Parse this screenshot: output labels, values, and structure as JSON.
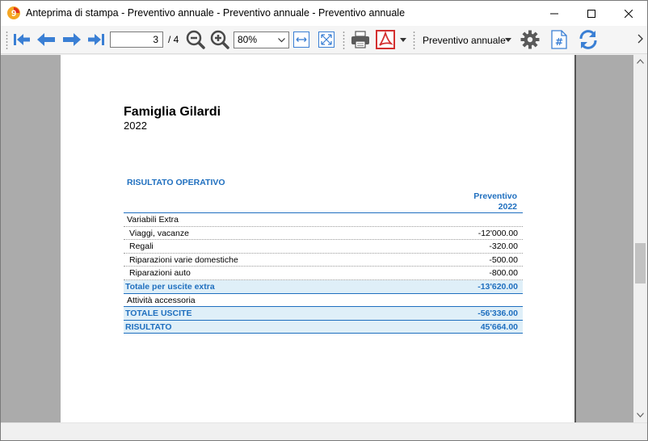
{
  "window": {
    "title": "Anteprima di stampa - Preventivo annuale - Preventivo annuale - Preventivo annuale"
  },
  "toolbar": {
    "page_current": "3",
    "page_total": "/ 4",
    "zoom": "80%",
    "report_name": "Preventivo annuale"
  },
  "report": {
    "title": "Famiglia Gilardi",
    "year": "2022",
    "section": "RISULTATO OPERATIVO",
    "column_header_1": "Preventivo",
    "column_header_2": "2022",
    "rows": [
      {
        "label": "Variabili Extra",
        "value": "",
        "kind": "group"
      },
      {
        "label": "Viaggi, vacanze",
        "value": "-12'000.00",
        "kind": "item"
      },
      {
        "label": "Regali",
        "value": "-320.00",
        "kind": "item"
      },
      {
        "label": "Riparazioni varie domestiche",
        "value": "-500.00",
        "kind": "item"
      },
      {
        "label": "Riparazioni auto",
        "value": "-800.00",
        "kind": "item"
      },
      {
        "label": "Totale per uscite extra",
        "value": "-13'620.00",
        "kind": "total"
      },
      {
        "label": "Attività accessoria",
        "value": "",
        "kind": "plain"
      },
      {
        "label": "TOTALE USCITE",
        "value": "-56'336.00",
        "kind": "total"
      },
      {
        "label": "RISULTATO",
        "value": "45'664.00",
        "kind": "total"
      }
    ]
  },
  "icons": {
    "app": "app-logo-icon",
    "first": "arrow-first-icon",
    "prev": "arrow-left-icon",
    "next": "arrow-right-icon",
    "last": "arrow-last-icon",
    "zoom_out": "zoom-out-icon",
    "zoom_in": "zoom-in-icon",
    "fit_width": "fit-width-icon",
    "fit_page": "fit-page-icon",
    "print": "printer-icon",
    "pdf": "pdf-icon",
    "settings": "gear-icon",
    "page_number": "page-number-icon",
    "refresh": "refresh-icon"
  },
  "colors": {
    "accent": "#1f6fbf",
    "total_bg": "#dfeff8",
    "workspace": "#ababab",
    "pdf_red": "#d32f2f"
  }
}
